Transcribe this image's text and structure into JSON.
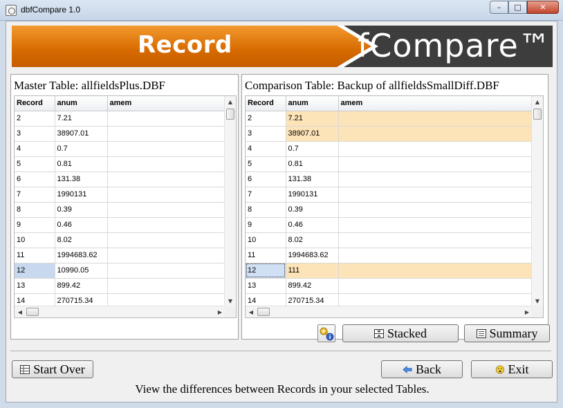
{
  "window": {
    "title": "dbfCompare 1.0",
    "minimize": "–",
    "maximize": "□",
    "close": "✕"
  },
  "banner": {
    "left_text": "Record",
    "right_text": "fCompare™"
  },
  "master": {
    "title": "Master Table: allfieldsPlus.DBF",
    "columns": [
      "Record",
      "anum",
      "amem"
    ],
    "rows": [
      [
        "2",
        "7.21",
        ""
      ],
      [
        "3",
        "38907.01",
        ""
      ],
      [
        "4",
        "0.7",
        ""
      ],
      [
        "5",
        "0.81",
        ""
      ],
      [
        "6",
        "131.38",
        ""
      ],
      [
        "7",
        "1990131",
        ""
      ],
      [
        "8",
        "0.39",
        ""
      ],
      [
        "9",
        "0.46",
        ""
      ],
      [
        "10",
        "8.02",
        ""
      ],
      [
        "11",
        "1994683.62",
        ""
      ],
      [
        "12",
        "10990.05",
        ""
      ],
      [
        "13",
        "899.42",
        ""
      ],
      [
        "14",
        "270715.34",
        ""
      ]
    ],
    "selected_row": 10
  },
  "comparison": {
    "title": "Comparison Table: Backup of allfieldsSmallDiff.DBF",
    "columns": [
      "Record",
      "anum",
      "amem"
    ],
    "rows": [
      [
        "2",
        "7.21",
        ""
      ],
      [
        "3",
        "38907.01",
        ""
      ],
      [
        "4",
        "0.7",
        ""
      ],
      [
        "5",
        "0.81",
        ""
      ],
      [
        "6",
        "131.38",
        ""
      ],
      [
        "7",
        "1990131",
        ""
      ],
      [
        "8",
        "0.39",
        ""
      ],
      [
        "9",
        "0.46",
        ""
      ],
      [
        "10",
        "8.02",
        ""
      ],
      [
        "11",
        "1994683.62",
        ""
      ],
      [
        "12",
        "111",
        ""
      ],
      [
        "13",
        "899.42",
        ""
      ],
      [
        "14",
        "270715.34",
        ""
      ]
    ],
    "diff_rows": [
      0,
      1,
      10
    ],
    "selected_row": 10
  },
  "buttons": {
    "stacked": "Stacked",
    "summary": "Summary",
    "start_over": "Start Over",
    "back": "Back",
    "exit": "Exit"
  },
  "status_text": "View the differences between Records in your selected Tables.",
  "colors": {
    "diff_highlight": "#fde4b8",
    "selection": "#c8d8ee",
    "banner_orange": "#e07a10"
  }
}
